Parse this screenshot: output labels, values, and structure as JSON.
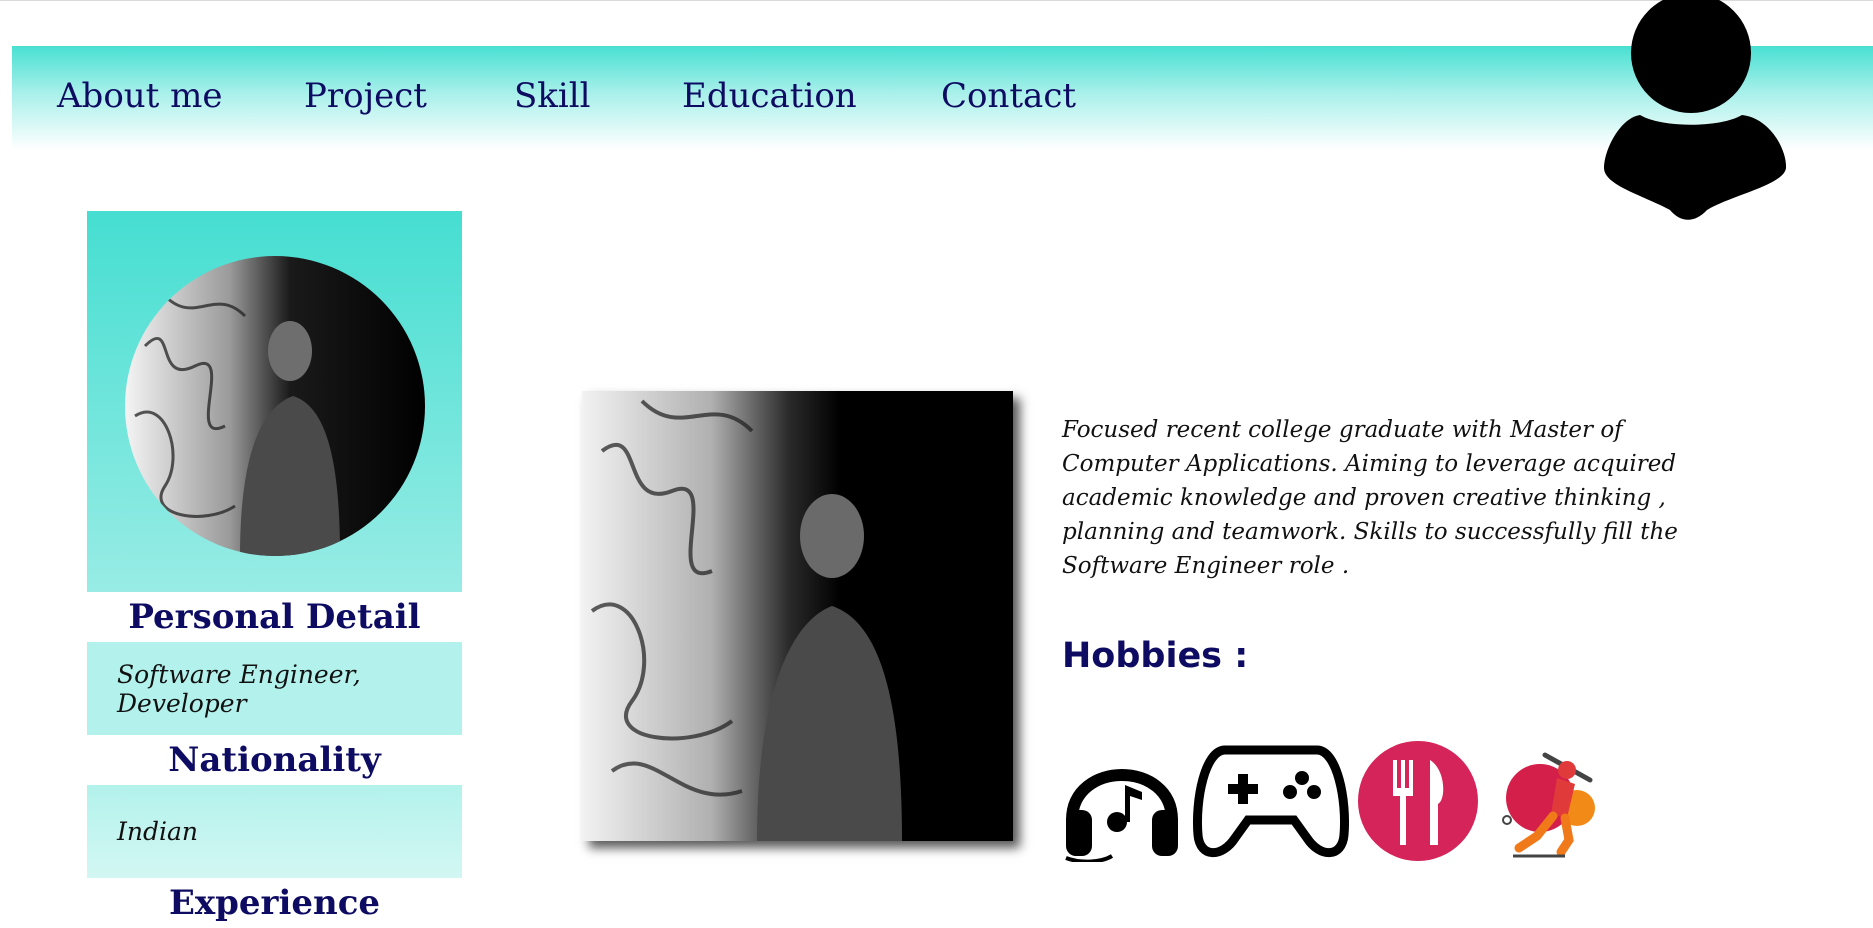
{
  "nav": {
    "items": [
      {
        "label": "About me"
      },
      {
        "label": "Project"
      },
      {
        "label": "Skill"
      },
      {
        "label": "Education"
      },
      {
        "label": "Contact"
      }
    ]
  },
  "profile": {
    "personal_detail_title": "Personal Detail",
    "personal_detail_value": "Software Engineer, Developer",
    "nationality_title": "Nationality",
    "nationality_value": "Indian",
    "experience_title": "Experience"
  },
  "about": {
    "description": "Focused recent college graduate with Master of Computer Applications. Aiming to leverage acquired academic knowledge and proven creative thinking , planning and teamwork. Skills to successfully fill the Software Engineer role ."
  },
  "hobbies": {
    "title": "Hobbies :",
    "icons": [
      "headphones-music-icon",
      "game-controller-icon",
      "fork-knife-icon",
      "cricket-batsman-icon"
    ]
  },
  "colors": {
    "accent_teal": "#45ded1",
    "navy_text": "#0e0c62",
    "light_teal_box": "#b3f2ec",
    "food_red": "#d4245a"
  }
}
